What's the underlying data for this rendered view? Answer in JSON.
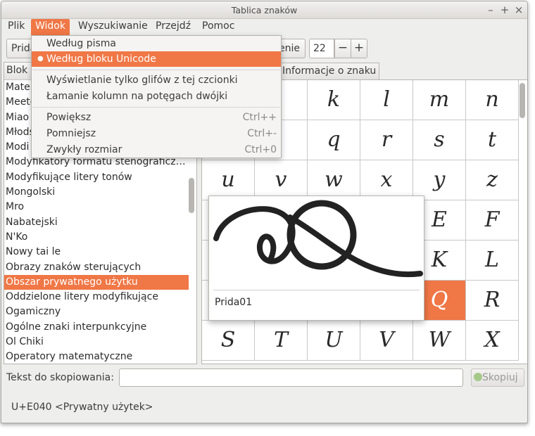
{
  "window": {
    "title": "Tablica znaków"
  },
  "window_controls": {
    "close": "×",
    "minimize": "–",
    "maximize": "+"
  },
  "menubar": [
    "Plik",
    "Widok",
    "Wyszukiwanie",
    "Przejdź",
    "Pomoc"
  ],
  "toolbar": {
    "font_button_label": "Prida",
    "size_label": "enie",
    "size_value": "22",
    "minus_label": "−",
    "plus_label": "+"
  },
  "left_panel": {
    "header": "Blok U",
    "blocks": [
      "Mater",
      "Meete",
      "Miao",
      "Młods",
      "Modi",
      "Modyfikatory formatu stenograficz…",
      "Modyfikujące litery tonów",
      "Mongolski",
      "Mro",
      "Nabatejski",
      "N'Ko",
      "Nowy tai le",
      "Obrazy znaków sterujących",
      "Obszar prywatnego użytku",
      "Oddzielone litery modyfikujące",
      "Ogamiczny",
      "Ogólne znaki interpunkcyjne",
      "Ol Chiki",
      "Operatory matematyczne"
    ],
    "selected_index": 13
  },
  "tabs": {
    "info": "Informacje o znaku"
  },
  "glyph_grid": {
    "rows": [
      [
        "",
        "",
        "k",
        "l",
        "m",
        "n"
      ],
      [
        "",
        "",
        "q",
        "r",
        "s",
        "t"
      ],
      [
        "u",
        "v",
        "w",
        "x",
        "y",
        "z"
      ],
      [
        "",
        "",
        "",
        "",
        "E",
        "F"
      ],
      [
        "",
        "",
        "",
        "",
        "K",
        "L"
      ],
      [
        "",
        "",
        "",
        "",
        "Q",
        "R"
      ],
      [
        "S",
        "T",
        "U",
        "V",
        "W",
        "X"
      ]
    ],
    "selected": {
      "row": 5,
      "col": 4
    }
  },
  "popup": {
    "glyph": "Q",
    "name": "Prida01"
  },
  "view_menu": {
    "items": [
      {
        "label": "Według pisma",
        "accel": ""
      },
      {
        "label": "Według bloku Unicode",
        "accel": ""
      },
      {
        "label": "Wyświetlanie tylko glifów z tej czcionki",
        "accel": ""
      },
      {
        "label": "Łamanie kolumn na potęgach dwójki",
        "accel": ""
      },
      {
        "label": "Powiększ",
        "accel": "Ctrl++"
      },
      {
        "label": "Pomniejsz",
        "accel": "Ctrl+-"
      },
      {
        "label": "Zwykły rozmiar",
        "accel": "Ctrl+0"
      }
    ],
    "selected_radio": 1
  },
  "copy": {
    "label": "Tekst do skopiowania:",
    "value": "",
    "button": "Skopiuj"
  },
  "status": "U+E040 <Prywatny użytek>",
  "colors": {
    "accent": "#f07746",
    "window_bg": "#eeeeec"
  }
}
